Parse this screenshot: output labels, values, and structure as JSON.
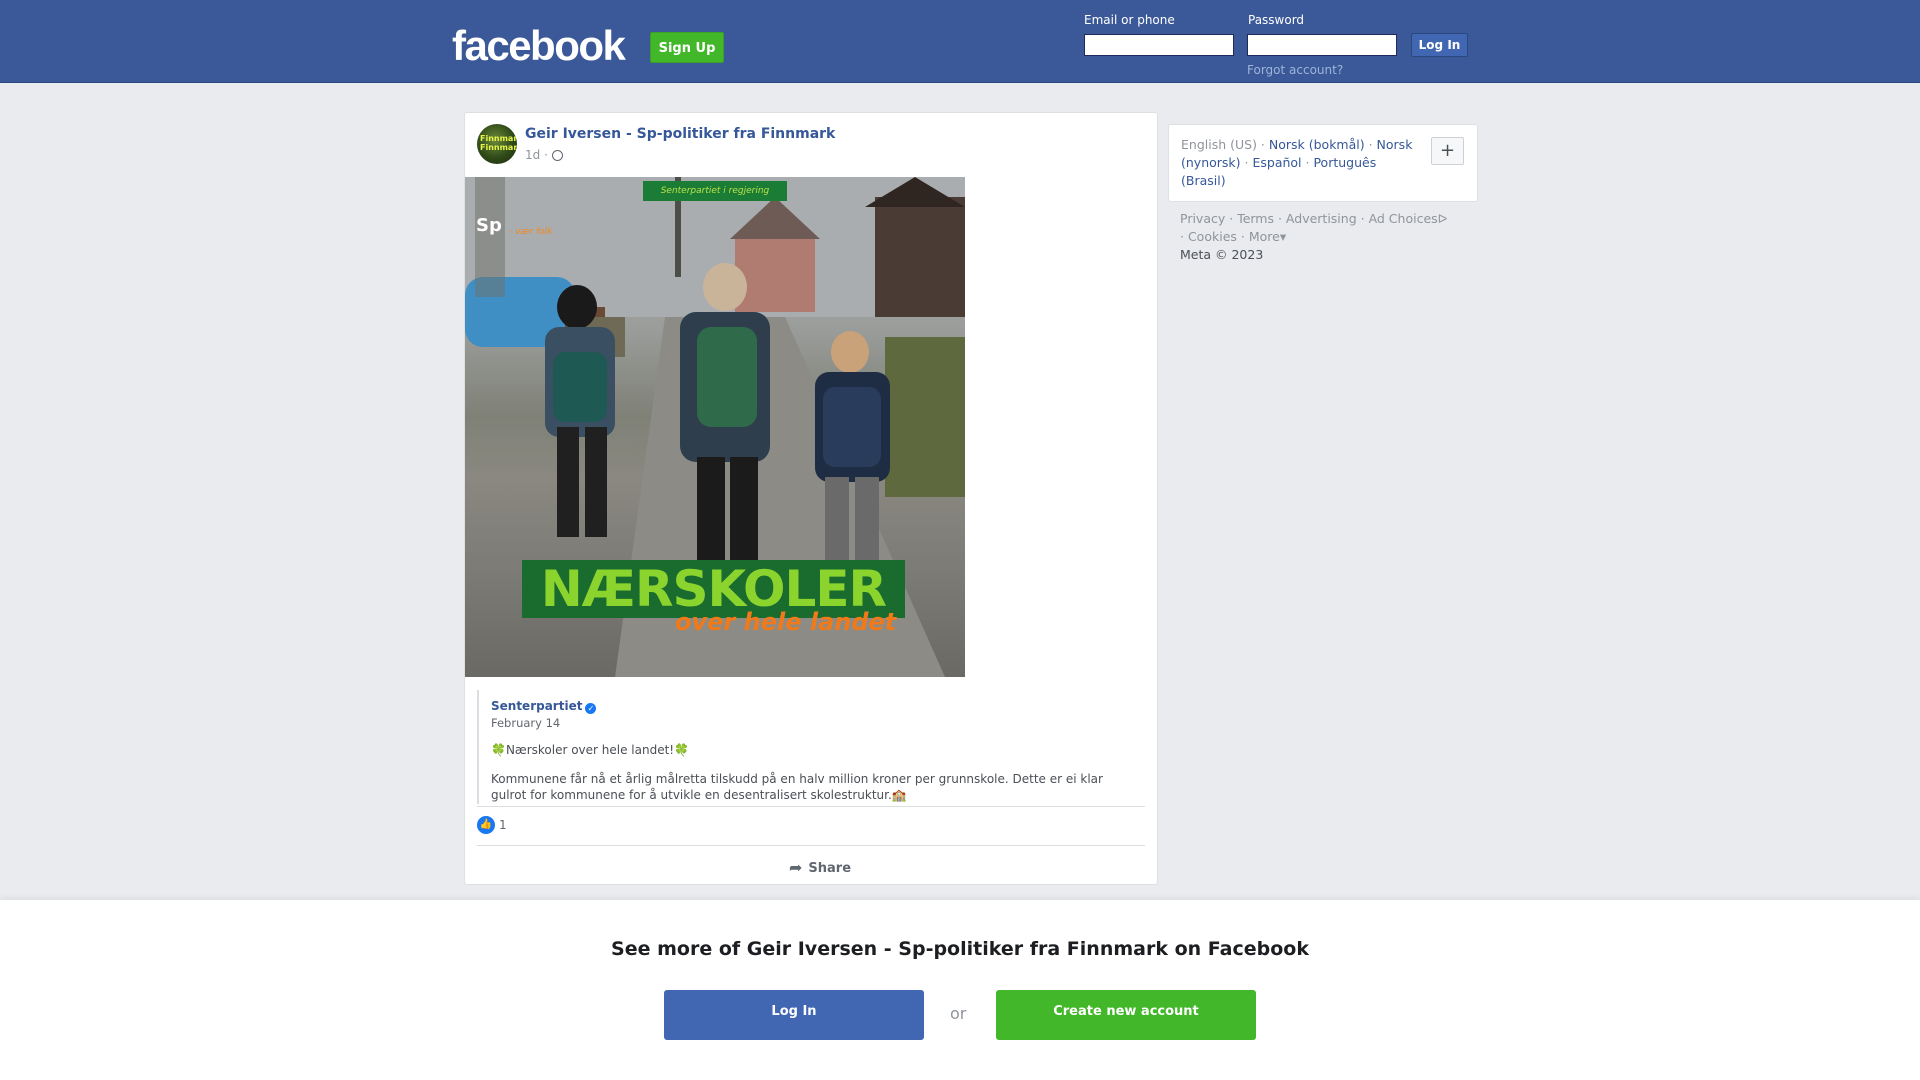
{
  "header": {
    "logo": "facebook",
    "signup_label": "Sign Up",
    "email_label": "Email or phone",
    "password_label": "Password",
    "login_label": "Log In",
    "forgot_label": "Forgot account?"
  },
  "post": {
    "author": "Geir Iversen - Sp-politiker fra Finnmark",
    "time": "1d ·",
    "avatar_text": "Finnmark Finnmark",
    "image": {
      "top_badge": "Senterpartiet i regjering",
      "logo": "Sp",
      "logo_sub": "- vær folk",
      "title": "NÆRSKOLER",
      "subtitle": "over hele landet"
    },
    "shared": {
      "page_name": "Senterpartiet",
      "verified_icon": "✓",
      "date": "February 14",
      "headline": "🍀Nærskoler over hele landet!🍀",
      "body": "Kommunene får nå et årlig målretta tilskudd på en halv million kroner per grunnskole. Dette er ei klar gulrot for kommunene for å utvikle en desentralisert skolestruktur.🏫"
    },
    "like_count": "1",
    "share_label": "Share"
  },
  "sidebar": {
    "languages": [
      "English (US)",
      "Norsk (bokmål)",
      "Norsk (nynorsk)",
      "Español",
      "Português (Brasil)"
    ],
    "plus_label": "+",
    "footer_links": [
      "Privacy",
      "Terms",
      "Advertising",
      "Ad Choices",
      "Cookies",
      "More"
    ],
    "copyright": "Meta © 2023"
  },
  "bottom": {
    "title": "See more of Geir Iversen - Sp-politiker fra Finnmark on Facebook",
    "login_label": "Log In",
    "or_label": "or",
    "create_label": "Create new account"
  },
  "colors": {
    "brand_blue": "#3b5998",
    "button_blue": "#4267b2",
    "green": "#42b72a",
    "link": "#365899"
  }
}
